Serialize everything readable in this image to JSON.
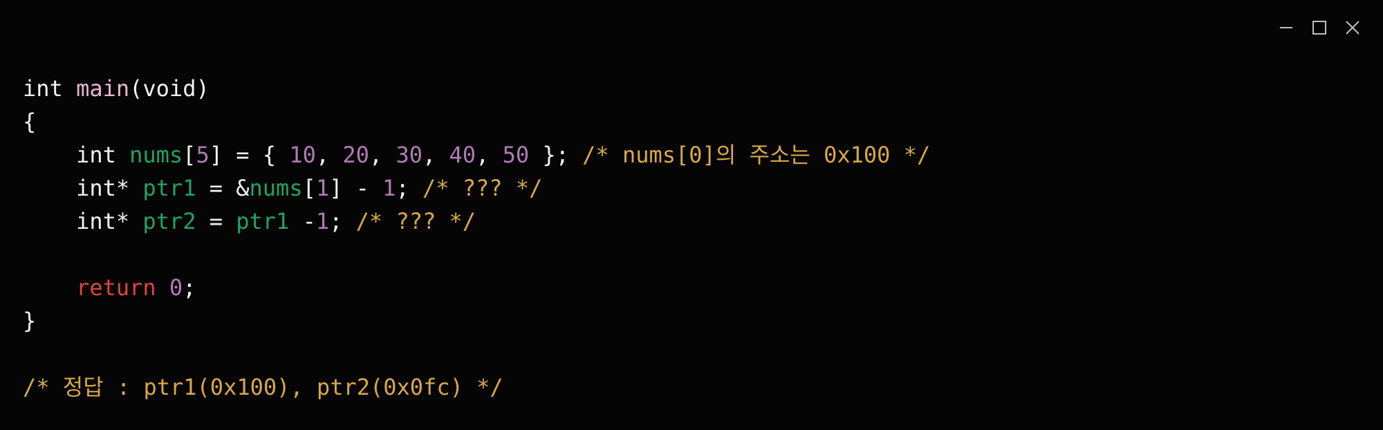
{
  "window": {
    "controls": [
      "minimize",
      "maximize",
      "close"
    ],
    "colors": {
      "background": "#050505",
      "plain": "#f2f2f2",
      "function": "#e8b7d2",
      "identifier": "#1fa463",
      "number": "#b17ab5",
      "comment": "#d9a847",
      "keyword_return": "#e0443c",
      "control_icon": "#bfbfbf"
    }
  },
  "code": {
    "lines": [
      [
        {
          "t": "kw",
          "v": "int "
        },
        {
          "t": "fn",
          "v": "main"
        },
        {
          "t": "pl",
          "v": "(void)"
        }
      ],
      [
        {
          "t": "pl",
          "v": "{"
        }
      ],
      [
        {
          "t": "pl",
          "v": "    "
        },
        {
          "t": "kw",
          "v": "int "
        },
        {
          "t": "id",
          "v": "nums"
        },
        {
          "t": "pl",
          "v": "["
        },
        {
          "t": "num",
          "v": "5"
        },
        {
          "t": "pl",
          "v": "] = { "
        },
        {
          "t": "num",
          "v": "10"
        },
        {
          "t": "pl",
          "v": ", "
        },
        {
          "t": "num",
          "v": "20"
        },
        {
          "t": "pl",
          "v": ", "
        },
        {
          "t": "num",
          "v": "30"
        },
        {
          "t": "pl",
          "v": ", "
        },
        {
          "t": "num",
          "v": "40"
        },
        {
          "t": "pl",
          "v": ", "
        },
        {
          "t": "num",
          "v": "50"
        },
        {
          "t": "pl",
          "v": " }; "
        },
        {
          "t": "cm",
          "v": "/* nums[0]의 주소는 0x100 */"
        }
      ],
      [
        {
          "t": "pl",
          "v": "    "
        },
        {
          "t": "kw",
          "v": "int* "
        },
        {
          "t": "id",
          "v": "ptr1"
        },
        {
          "t": "pl",
          "v": " = &"
        },
        {
          "t": "id",
          "v": "nums"
        },
        {
          "t": "pl",
          "v": "["
        },
        {
          "t": "num",
          "v": "1"
        },
        {
          "t": "pl",
          "v": "] - "
        },
        {
          "t": "num",
          "v": "1"
        },
        {
          "t": "pl",
          "v": "; "
        },
        {
          "t": "cm",
          "v": "/* ??? */"
        }
      ],
      [
        {
          "t": "pl",
          "v": "    "
        },
        {
          "t": "kw",
          "v": "int* "
        },
        {
          "t": "id",
          "v": "ptr2"
        },
        {
          "t": "pl",
          "v": " = "
        },
        {
          "t": "id",
          "v": "ptr1"
        },
        {
          "t": "pl",
          "v": " -"
        },
        {
          "t": "num",
          "v": "1"
        },
        {
          "t": "pl",
          "v": "; "
        },
        {
          "t": "cm",
          "v": "/* ??? */"
        }
      ],
      [],
      [
        {
          "t": "pl",
          "v": "    "
        },
        {
          "t": "ret",
          "v": "return "
        },
        {
          "t": "num",
          "v": "0"
        },
        {
          "t": "pl",
          "v": ";"
        }
      ],
      [
        {
          "t": "pl",
          "v": "}"
        }
      ],
      [],
      [
        {
          "t": "cm",
          "v": "/* 정답 : ptr1(0x100), ptr2(0x0fc) */"
        }
      ]
    ]
  }
}
